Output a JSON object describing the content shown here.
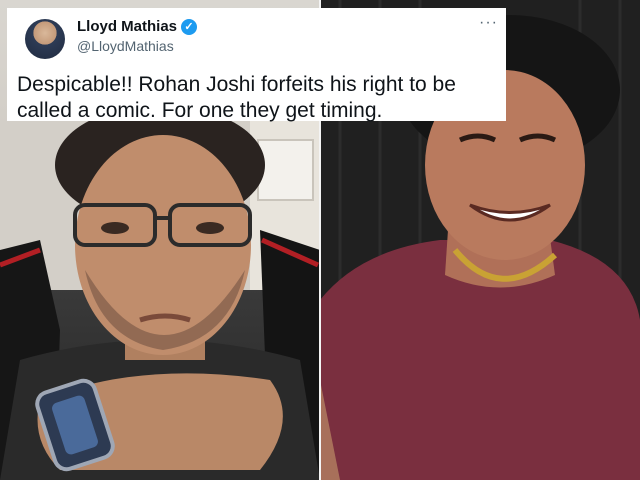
{
  "tweet": {
    "display_name": "Lloyd Mathias",
    "handle": "@LloydMathias",
    "verified_icon": "✓",
    "more_icon": "···",
    "text": "Despicable!! Rohan Joshi forfeits his right to be called a comic. For one they get timing."
  },
  "colors": {
    "verified": "#1d9bf0",
    "name_text": "#0f1419",
    "handle_text": "#536471"
  }
}
